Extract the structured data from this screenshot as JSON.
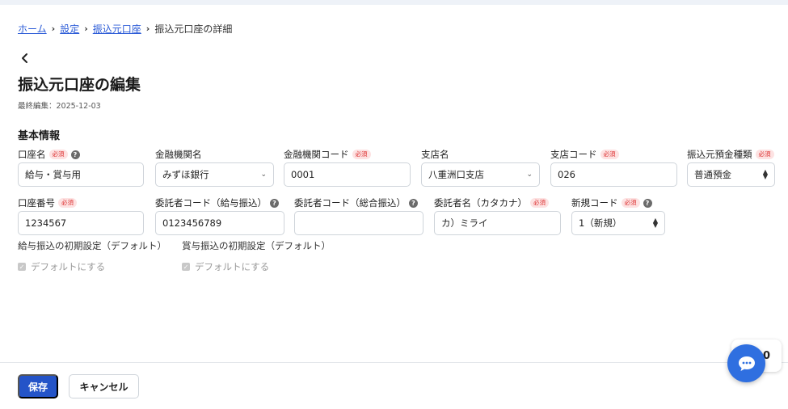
{
  "breadcrumb": {
    "home": "ホーム",
    "settings": "設定",
    "accounts": "振込元口座",
    "current": "振込元口座の詳細"
  },
  "page": {
    "title": "振込元口座の編集",
    "last_edited": "最終編集：2025-12-03",
    "section_title": "基本情報"
  },
  "required_label": "必須",
  "fields": {
    "account_name": {
      "label": "口座名",
      "value": "給与・賞与用"
    },
    "bank_name": {
      "label": "金融機関名",
      "value": "みずほ銀行"
    },
    "bank_code": {
      "label": "金融機関コード",
      "value": "0001"
    },
    "branch_name": {
      "label": "支店名",
      "value": "八重洲口支店"
    },
    "branch_code": {
      "label": "支店コード",
      "value": "026"
    },
    "deposit_type": {
      "label": "振込元預金種類",
      "value": "普通預金"
    },
    "account_number": {
      "label": "口座番号",
      "value": "1234567"
    },
    "consignor_code_salary": {
      "label": "委託者コード（給与振込）",
      "value": "0123456789"
    },
    "consignor_code_general": {
      "label": "委託者コード（総合振込）",
      "value": ""
    },
    "consignor_name_kana": {
      "label": "委託者名（カタカナ）",
      "value": "カ）ミライ"
    },
    "new_code": {
      "label": "新規コード",
      "value": "1（新規）"
    }
  },
  "defaults": {
    "salary": {
      "label": "給与振込の初期設定（デフォルト）",
      "checkbox": "デフォルトにする"
    },
    "bonus": {
      "label": "賞与振込の初期設定（デフォルト）",
      "checkbox": "デフォルトにする"
    }
  },
  "buttons": {
    "save": "保存",
    "cancel": "キャンセル"
  },
  "floating_badge": "0",
  "icons": {
    "back": "chevron-left-icon",
    "help": "question-circle-icon",
    "chat": "chat-bubble-icon"
  },
  "colors": {
    "primary": "#2454c8",
    "link": "#2b5bd7",
    "required_bg": "#fde2e2",
    "required_text": "#dd3333",
    "chat": "#2f6fe0"
  }
}
